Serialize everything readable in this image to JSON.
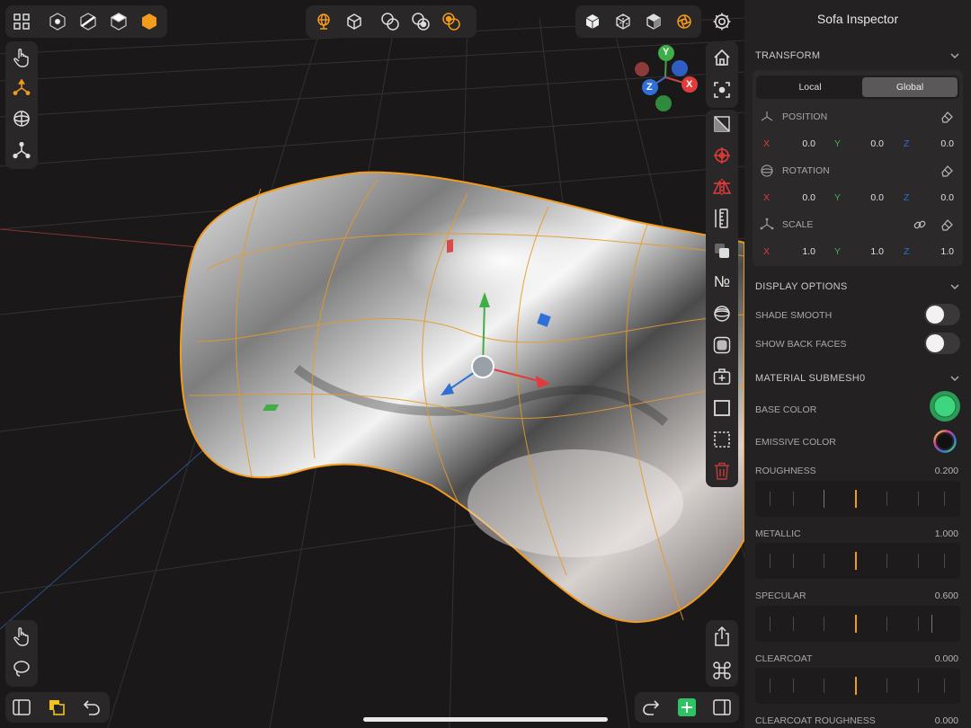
{
  "panel": {
    "title": "Sofa Inspector",
    "transform": {
      "header": "TRANSFORM",
      "mode_local": "Local",
      "mode_global": "Global",
      "position_label": "POSITION",
      "rotation_label": "ROTATION",
      "scale_label": "SCALE",
      "axis_x": "X",
      "axis_y": "Y",
      "axis_z": "Z",
      "position": [
        "0.0",
        "0.0",
        "0.0"
      ],
      "rotation": [
        "0.0",
        "0.0",
        "0.0"
      ],
      "scale": [
        "1.0",
        "1.0",
        "1.0"
      ]
    },
    "display": {
      "header": "DISPLAY OPTIONS",
      "shade_smooth": "SHADE SMOOTH",
      "show_back_faces": "SHOW BACK FACES"
    },
    "material": {
      "header": "MATERIAL  SUBMESH0",
      "base_color": "BASE COLOR",
      "emissive_color": "EMISSIVE COLOR",
      "roughness": "ROUGHNESS",
      "roughness_val": "0.200",
      "metallic": "METALLIC",
      "metallic_val": "1.000",
      "specular": "SPECULAR",
      "specular_val": "0.600",
      "clearcoat": "CLEARCOAT",
      "clearcoat_val": "0.000",
      "clearcoat_roughness": "CLEARCOAT ROUGHNESS",
      "clearcoat_roughness_val": "0.000",
      "base_color_hex": "#3fd57f"
    }
  },
  "gizmo": {
    "x": "X",
    "y": "Y",
    "z": "Z"
  },
  "right_tools": {
    "number_label": "№"
  },
  "colors": {
    "accent": "#f29b1d",
    "x_axis": "#e23b3b",
    "y_axis": "#3fae49",
    "z_axis": "#2f6fd6"
  }
}
